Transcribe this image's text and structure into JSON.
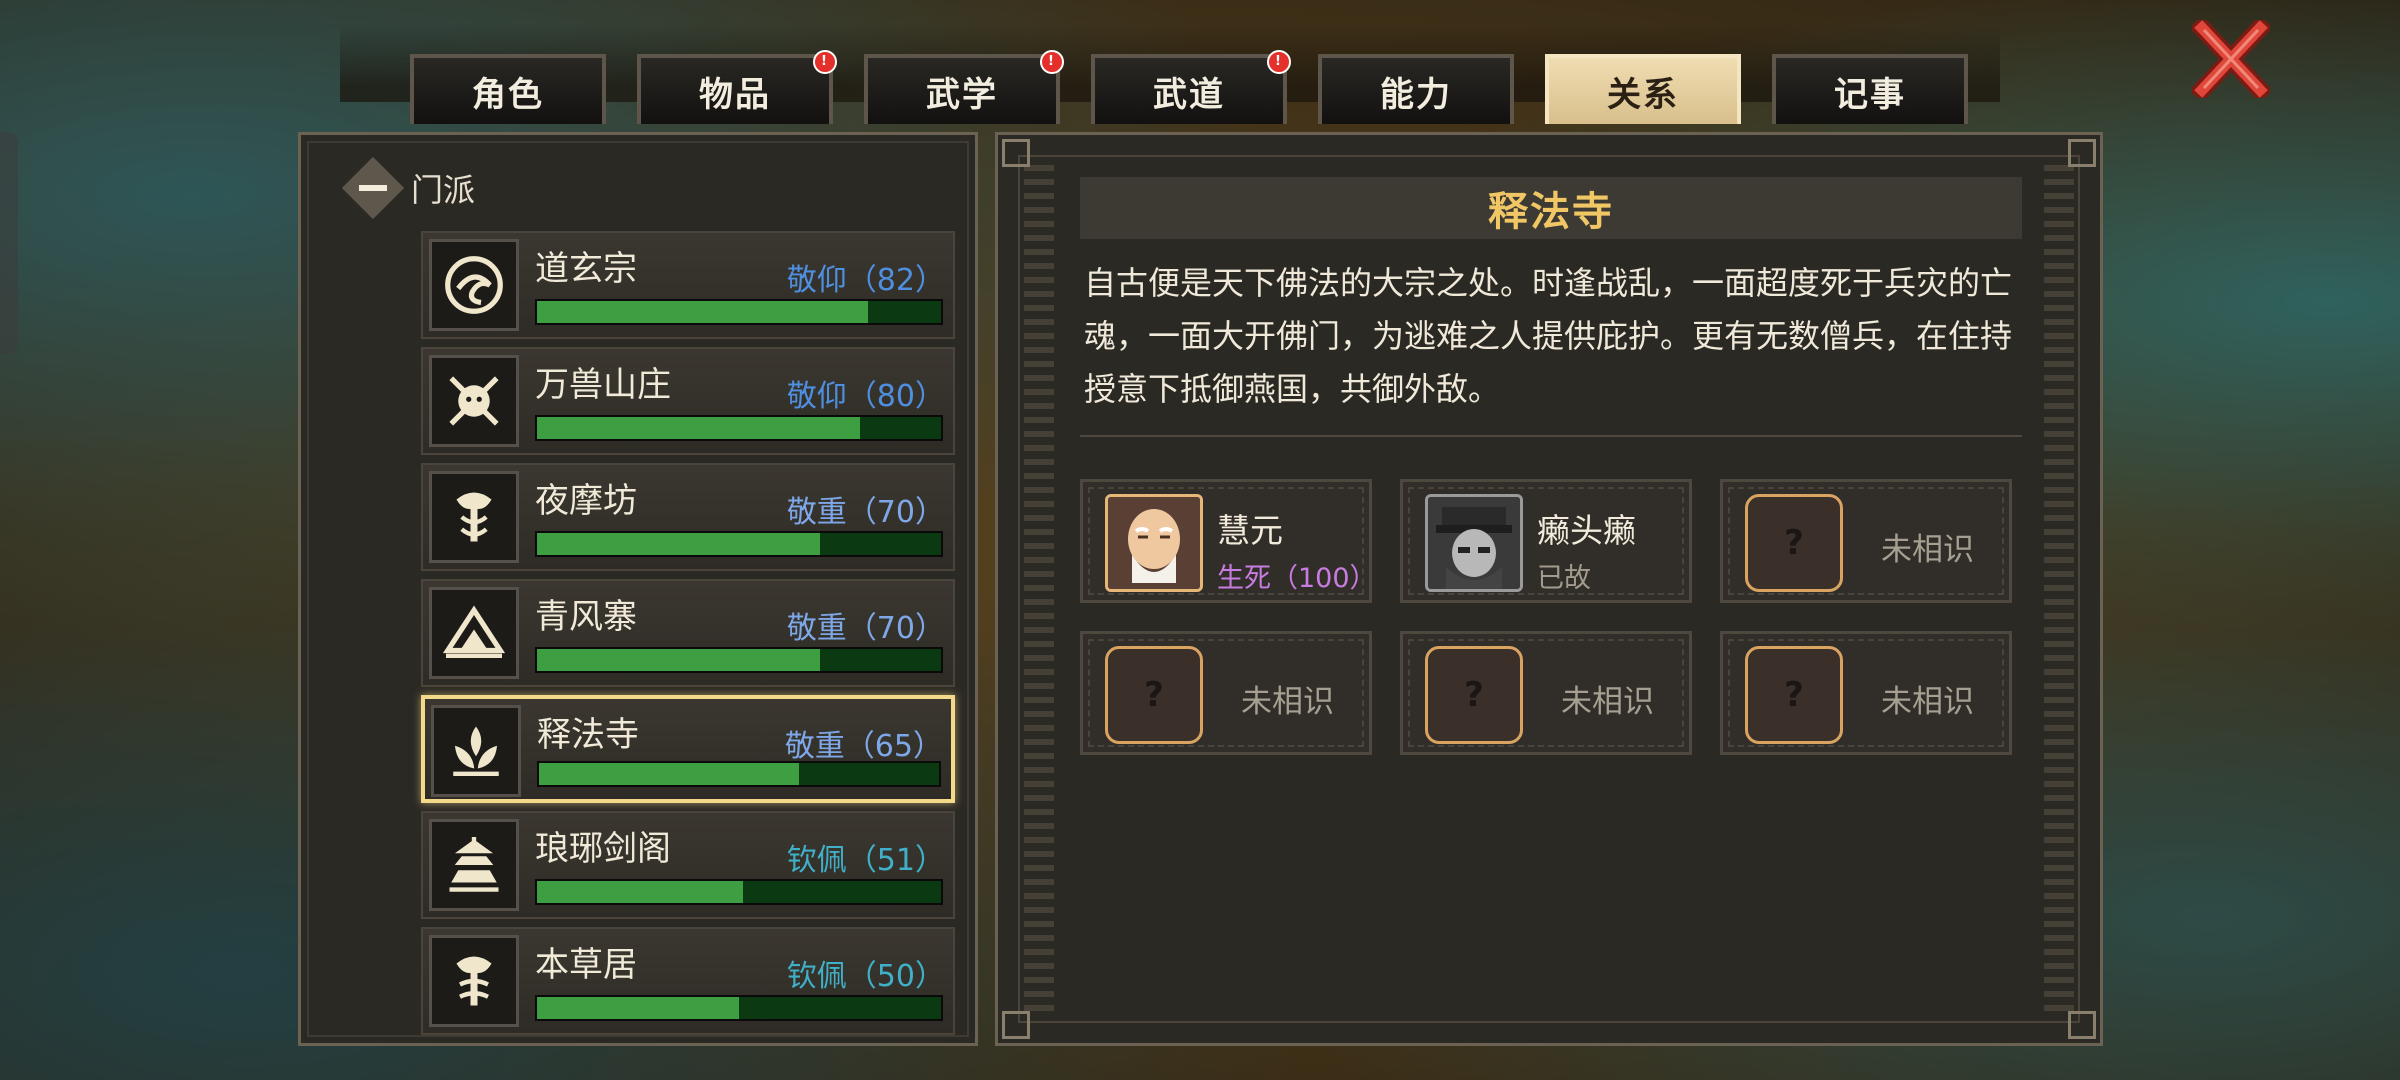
{
  "tabs": [
    {
      "label": "角色",
      "badge": false,
      "active": false
    },
    {
      "label": "物品",
      "badge": true,
      "active": false
    },
    {
      "label": "武学",
      "badge": true,
      "active": false
    },
    {
      "label": "武道",
      "badge": true,
      "active": false
    },
    {
      "label": "能力",
      "badge": false,
      "active": false
    },
    {
      "label": "关系",
      "badge": false,
      "active": true
    },
    {
      "label": "记事",
      "badge": false,
      "active": false
    }
  ],
  "badge_mark": "!",
  "close_icon": "close-x-icon",
  "group": {
    "label": "门派",
    "collapse_symbol": "—"
  },
  "factions": [
    {
      "name": "道玄宗",
      "attitude": "敬仰（82）",
      "level": 82,
      "color": "#4f8fe0",
      "emblem": "crane-emblem-icon"
    },
    {
      "name": "万兽山庄",
      "attitude": "敬仰（80）",
      "level": 80,
      "color": "#4f8fe0",
      "emblem": "beast-emblem-icon"
    },
    {
      "name": "夜摩坊",
      "attitude": "敬重（70）",
      "level": 70,
      "color": "#7ea7e8",
      "emblem": "serpent-emblem-icon"
    },
    {
      "name": "青风寨",
      "attitude": "敬重（70）",
      "level": 70,
      "color": "#7ea7e8",
      "emblem": "mountain-emblem-icon"
    },
    {
      "name": "释法寺",
      "attitude": "敬重（65）",
      "level": 65,
      "color": "#7ea7e8",
      "emblem": "lotus-emblem-icon",
      "selected": true
    },
    {
      "name": "琅琊剑阁",
      "attitude": "钦佩（51）",
      "level": 51,
      "color": "#3fb0c8",
      "emblem": "pagoda-emblem-icon"
    },
    {
      "name": "本草居",
      "attitude": "钦佩（50）",
      "level": 50,
      "color": "#3fb0c8",
      "emblem": "herb-emblem-icon"
    }
  ],
  "detail": {
    "title": "释法寺",
    "description": "自古便是天下佛法的大宗之处。时逢战乱，一面超度死于兵灾的亡魂，一面大开佛门，为逃难之人提供庇护。更有无数僧兵，在住持授意下抵御燕国，共御外敌。",
    "npcs": [
      {
        "name": "慧元",
        "status": "生死（100）",
        "status_color": "#c77ce0",
        "known": true,
        "portrait": "monk-portrait-icon"
      },
      {
        "name": "癞头癞",
        "status": "已故",
        "status_color": "#a39b8d",
        "known": true,
        "portrait": "hatted-man-portrait-icon",
        "gray": true
      },
      {
        "name": "未相识",
        "known": false
      },
      {
        "name": "未相识",
        "known": false
      },
      {
        "name": "未相识",
        "known": false
      },
      {
        "name": "未相识",
        "known": false
      }
    ],
    "unknown_mark": "?"
  }
}
